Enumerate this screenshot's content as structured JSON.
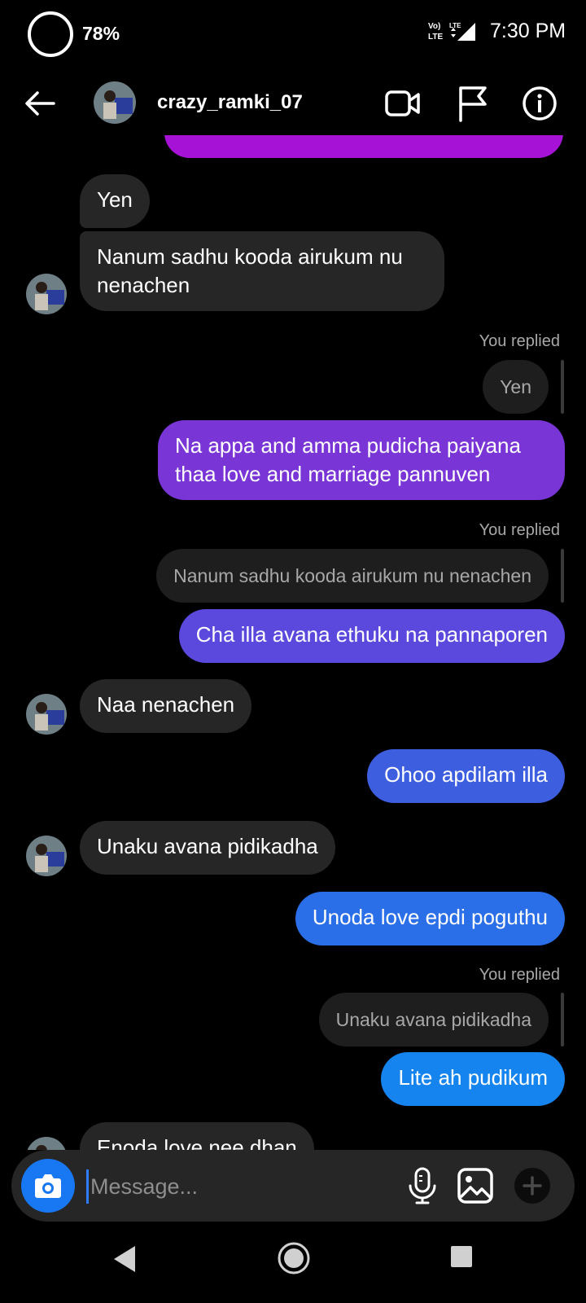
{
  "status": {
    "battery": "78%",
    "network": "Vo) LTE LTE",
    "time": "7:30 PM"
  },
  "header": {
    "username": "crazy_ramki_07"
  },
  "messages": {
    "m1": "Yen",
    "m2a": "Nanum sadhu kooda airukum nu",
    "m2b": "nenachen",
    "replied1": "You replied",
    "q1": "Yen",
    "m3a": "Na appa and amma pudicha paiyana",
    "m3b": "thaa love and marriage pannuven",
    "replied2": "You replied",
    "q2": "Nanum sadhu kooda airukum nu nenachen",
    "m4": "Cha illa avana ethuku na pannaporen",
    "m5": "Naa nenachen",
    "m6": "Ohoo apdilam illa",
    "m7": "Unaku avana pidikadha",
    "m8": "Unoda love epdi poguthu",
    "replied3": "You replied",
    "q3": "Unaku avana pidikadha",
    "m9": "Lite ah pudikum",
    "m10": "Enoda love nee dhan"
  },
  "composer": {
    "placeholder": "Message..."
  },
  "icons": [
    "back-arrow-icon",
    "video-call-icon",
    "flag-icon",
    "info-icon",
    "camera-icon",
    "microphone-icon",
    "gallery-icon",
    "plus-icon"
  ],
  "colors": {
    "bg": "#000000",
    "received": "#262626",
    "quoted": "#1e1e1e",
    "gradient_purple": "#a713d6",
    "sent_violet": "#7a35d6",
    "sent_indigo": "#5a49dc",
    "sent_blue": "#3e5ee0",
    "sent_royal": "#2b6fe8",
    "sent_azure": "#1684ee",
    "camera_blue": "#1877f2"
  }
}
